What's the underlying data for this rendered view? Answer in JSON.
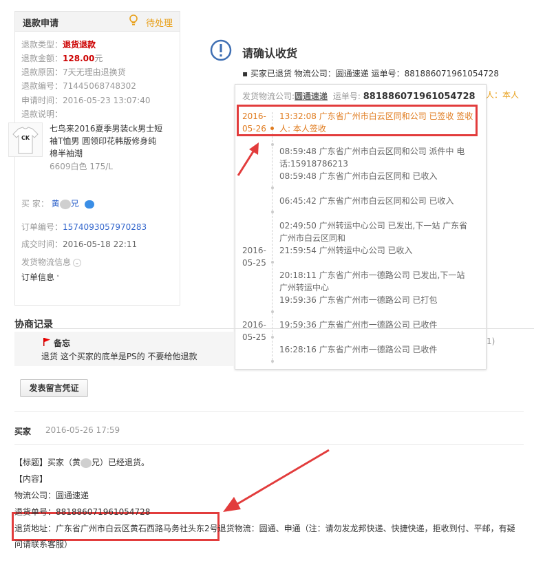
{
  "panel": {
    "title": "退款申请",
    "status": "待处理",
    "fields": [
      {
        "key": "退款类型：",
        "value": "退货退款"
      },
      {
        "key": "退款金额：",
        "value": "128.00",
        "unit": "元"
      },
      {
        "key": "退款原因：",
        "value": "7天无理由退换货"
      },
      {
        "key": "退款编号：",
        "value": "71445068748302"
      },
      {
        "key": "申请时间：",
        "value": "2016-05-23 13:07:40"
      },
      {
        "key": "退款说明：",
        "value": ""
      }
    ],
    "product": {
      "title": "七鸟来2016夏季男装ck男士短袖T恤男 圆领印花韩版修身纯棉半袖潮",
      "sku": "6609白色    175/L"
    },
    "buyer_label": "买    家：",
    "buyer_name_a": "黄",
    "buyer_name_b": "兄",
    "order": [
      {
        "key": "订单编号：",
        "value": "1574093057970283"
      },
      {
        "key": "成交时间：",
        "value": "2016-05-18 22:11"
      }
    ],
    "logistics_toggle": "发货物流信息",
    "order_toggle": "订单信息"
  },
  "confirm": {
    "title": "请确认收货",
    "line": "买家已退货 物流公司：圆通速递 运单号：881886071961054728",
    "side_text": "人：本人",
    "side_text2": "1)"
  },
  "popup": {
    "hdr_label": "发货物流公司:",
    "company": "圆通速递",
    "waybill_label": "运单号:",
    "waybill": "881886071961054728",
    "dates": [
      {
        "text": "2016-05-26",
        "highlight": true
      },
      {
        "text": "2016-05-25",
        "highlight": false
      },
      {
        "text": "2016-05-25",
        "highlight": false
      }
    ],
    "events": [
      {
        "text": "13:32:08 广东省广州市白云区同和公司 已签收 签收人: 本人签收",
        "highlight": true
      },
      {
        "text": "08:59:48 广东省广州市白云区同和公司 派件中 电话:15918786213",
        "highlight": false
      },
      {
        "text": "08:59:48 广东省广州市白云区同和 已收入",
        "highlight": false
      },
      {
        "text": "06:45:42 广东省广州市白云区同和公司 已收入",
        "highlight": false
      },
      {
        "text": "02:49:50 广州转运中心公司 已发出,下一站 广东省广州市白云区同和",
        "highlight": false
      },
      {
        "text": "21:59:54 广州转运中心公司 已收入",
        "highlight": false
      },
      {
        "text": "20:18:11 广东省广州市一德路公司 已发出,下一站 广州转运中心",
        "highlight": false
      },
      {
        "text": "19:59:36 广东省广州市一德路公司 已打包",
        "highlight": false
      },
      {
        "text": "19:59:36 广东省广州市一德路公司 已收件",
        "highlight": false
      },
      {
        "text": "16:28:16 广东省广州市一德路公司 已收件",
        "highlight": false
      }
    ]
  },
  "negotiation": {
    "title": "协商记录",
    "note_title": "备忘",
    "note_text": "退货 这个买家的底单是PS的 不要给他退款",
    "post_button": "发表留言凭证",
    "buyer": "买家",
    "time": "2016-05-26 17:59",
    "msg_title_a": "【标题】买家（黄",
    "msg_title_b": "兄）已经退货。",
    "msg_content_label": "【内容】",
    "msg_company": "物流公司：圆通速递",
    "msg_waybill": "退货单号：881886071961054728",
    "msg_address": "退货地址：广东省广州市白云区黄石西路马务社头东2号",
    "msg_address_tail": "退货物流：圆通、申通（注：请勿发龙邦快递、快捷快递，拒收到付、平邮，有疑",
    "msg_last": "问请联系客服）"
  },
  "colors": {
    "status": "#e8a01b",
    "highlight": "#e07b1e",
    "alert_red": "#e23c3c",
    "link": "#3366cc"
  }
}
